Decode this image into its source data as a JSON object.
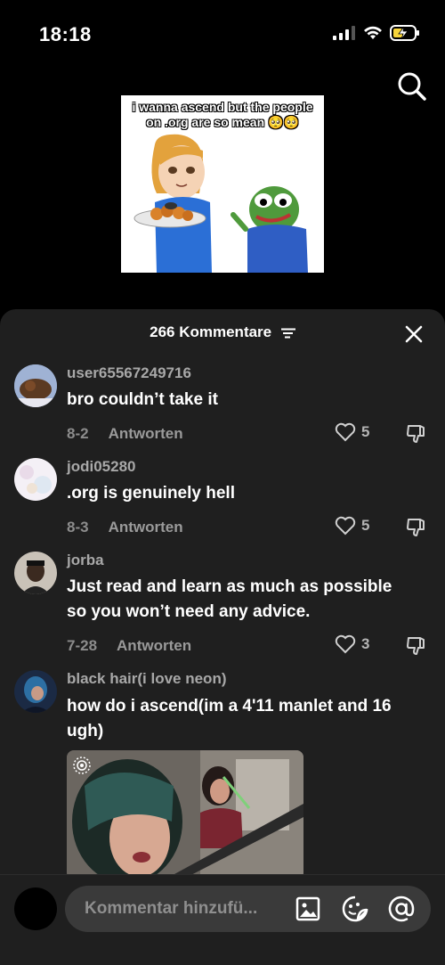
{
  "status_bar": {
    "time": "18:18"
  },
  "video": {
    "meme_text_line1": "i wanna ascend but the people",
    "meme_text_line2": "on .org are so mean 🥺🥺"
  },
  "comments_sheet": {
    "count_label": "266 Kommentare",
    "comments": [
      {
        "username": "user65567249716",
        "text": "bro couldn’t take it",
        "date": "8-2",
        "reply": "Antworten",
        "likes": "5"
      },
      {
        "username": "jodi05280",
        "text": ".org is genuinely hell",
        "date": "8-3",
        "reply": "Antworten",
        "likes": "5"
      },
      {
        "username": "jorba",
        "text_line1": "Just read and learn as much as possible",
        "text_line2": "so you won’t need any advice.",
        "date": "7-28",
        "reply": "Antworten",
        "likes": "3"
      },
      {
        "username": "black hair(i love neon)",
        "text_line1": "how do i ascend(im a 4'11 manlet and 16",
        "text_line2": "ugh)"
      }
    ]
  },
  "input": {
    "placeholder": "Kommentar hinzufü..."
  },
  "colors": {
    "sheet_bg": "#1f1f1f",
    "input_bg": "#3a3a3a",
    "muted_text": "#a8a8a8"
  }
}
